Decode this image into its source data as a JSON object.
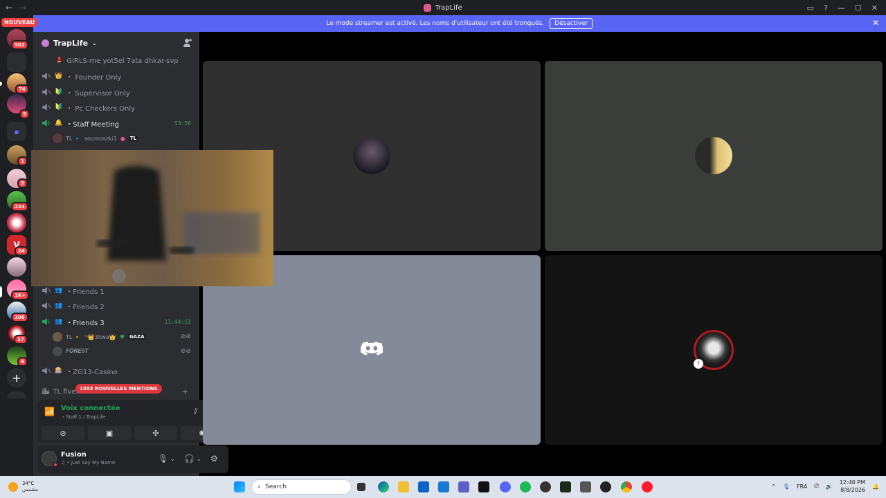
{
  "window": {
    "title": "TrapLife"
  },
  "banner": {
    "text": "Le mode streamer est activé. Les noms d'utilisateur ont été tronqués.",
    "button": "Désactiver"
  },
  "rail": {
    "nouveau": "NOUVEAU",
    "badges": [
      "502",
      "74",
      "9",
      "1",
      "9",
      "224",
      "24",
      "1K+",
      "206",
      "37",
      "9"
    ]
  },
  "server": {
    "name": "TrapLife"
  },
  "channels": [
    {
      "emoji": "💄",
      "name": "GIRLS-me yot5el 7ata dhkar-svp"
    },
    {
      "emoji": "👑",
      "name": "・ Founder Only"
    },
    {
      "emoji": "🔰",
      "name": "・ Supervisor Only"
    },
    {
      "emoji": "🔰",
      "name": "・ Pc Checkers Only"
    },
    {
      "emoji": "🔔",
      "name": "・Staff Meeting",
      "time": "53:56"
    }
  ],
  "staff_user": {
    "prefix": "TL 🔹",
    "name": "soumoszki1",
    "tag": "TL"
  },
  "channels2": [
    {
      "emoji": "👥",
      "name": "・Friends 1"
    },
    {
      "emoji": "👥",
      "name": "・Friends 2"
    },
    {
      "emoji": "👥",
      "name": "・Friends 3",
      "time": "11:44:51"
    }
  ],
  "friends_users": [
    {
      "prefix": "TL 🔸",
      "name": "ᴵᴮ👑3liwa👑",
      "tag": "GAZA"
    },
    {
      "prefix": "",
      "name": "𝑭𝑶𝑹𝑬𝑺𝑻",
      "tag": ""
    }
  ],
  "channels3": [
    {
      "emoji": "🎰",
      "name": "・ZG13-Casino"
    },
    {
      "emoji": "🏙",
      "name": "TL fivem"
    }
  ],
  "mentions": "1593 NOUVELLES MENTIONS",
  "voice": {
    "status": "Voix connectée",
    "channel": "・Staff 1 / TrapLife"
  },
  "user": {
    "name": "Fusion",
    "status": "♫ • Just Say My Name"
  },
  "taskbar": {
    "weather_temp": "34°C",
    "weather_desc": "مشمس",
    "search_placeholder": "Search",
    "lang": "FRA",
    "time": "12:40 PM",
    "date": "8/8/2026"
  },
  "colors": {
    "accent": "#5865f2",
    "voice_green": "#23a55a",
    "badge_red": "#f23f43"
  }
}
